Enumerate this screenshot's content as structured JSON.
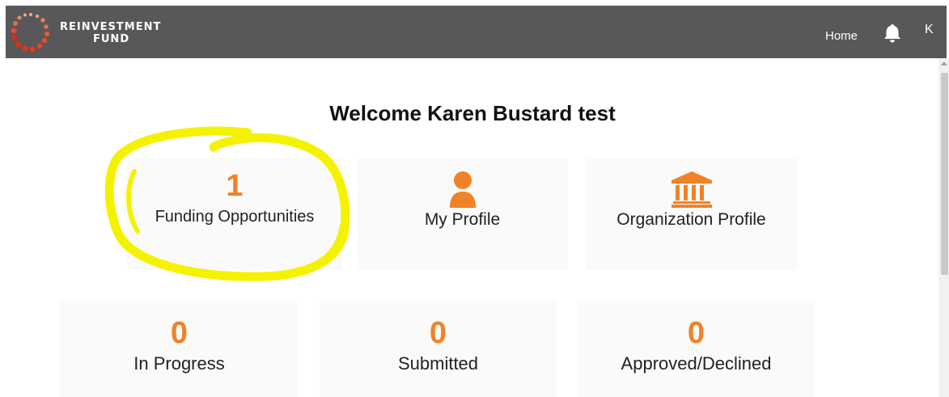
{
  "header": {
    "brand_line1": "REINVESTMENT",
    "brand_line2": "FUND",
    "nav_home": "Home",
    "user_initial": "K",
    "logo_icon": "reinvestment-fund-logo",
    "bell_icon": "notification-bell-icon"
  },
  "welcome": "Welcome Karen Bustard test",
  "cards": {
    "funding": {
      "count": "1",
      "label": "Funding Opportunities"
    },
    "profile": {
      "label": "My Profile",
      "icon": "person-icon"
    },
    "organization": {
      "label": "Organization Profile",
      "icon": "bank-building-icon"
    }
  },
  "stats": {
    "in_progress": {
      "count": "0",
      "label": "In Progress"
    },
    "submitted": {
      "count": "0",
      "label": "Submitted"
    },
    "approved_declined": {
      "count": "0",
      "label": "Approved/Declined"
    }
  },
  "colors": {
    "header_bg": "#58585a",
    "accent_orange": "#f08228",
    "highlight_yellow": "#f5f200"
  }
}
